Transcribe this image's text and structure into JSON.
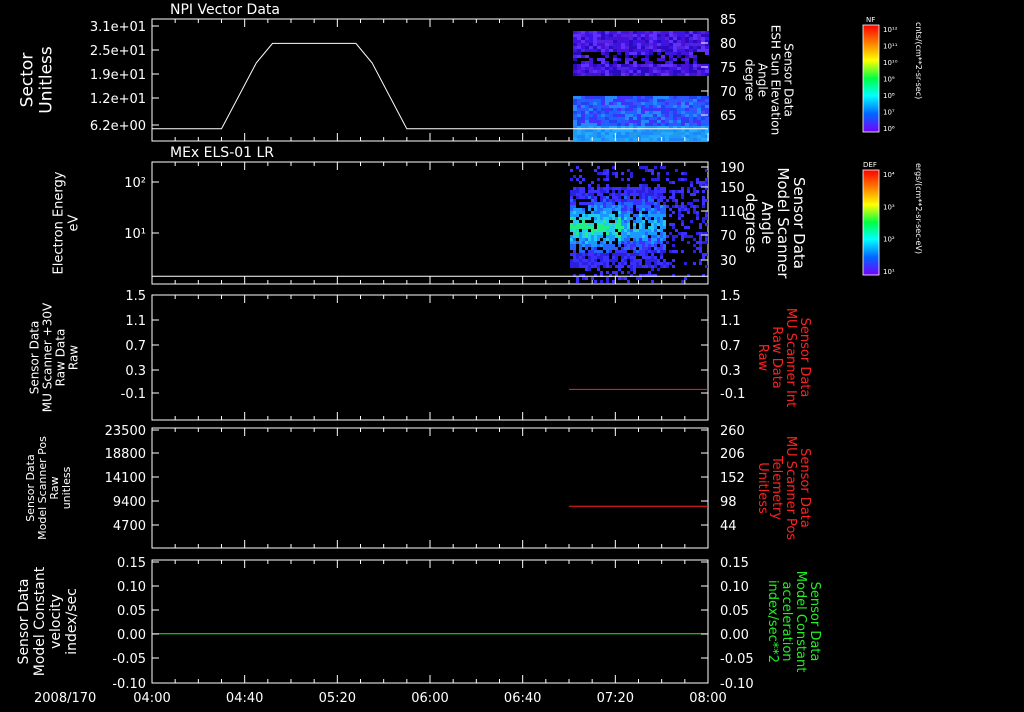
{
  "date_label": "2008/170",
  "time_ticks": [
    "04:00",
    "04:40",
    "05:20",
    "06:00",
    "06:40",
    "07:20",
    "08:00"
  ],
  "colors": {
    "white": "#ffffff",
    "red": "#ff2020",
    "green": "#22ee22"
  },
  "chart_data": [
    {
      "type": "line",
      "title": "NPI Vector Data",
      "left_axis": {
        "label_lines": [
          "Sector",
          "Unitless"
        ],
        "ticks": [
          "3.1e+01",
          "2.5e+01",
          "1.9e+01",
          "1.2e+01",
          "6.2e+00"
        ]
      },
      "right_axis": {
        "label_lines": [
          "Sensor Data",
          "ESH Sun Elevation",
          "Angle",
          "degree"
        ],
        "ticks": [
          "85",
          "80",
          "75",
          "70",
          "65"
        ],
        "ylim": [
          60,
          85
        ]
      },
      "series": [
        {
          "x": [
            "04:00",
            "04:30",
            "04:45",
            "04:52",
            "05:28",
            "05:35",
            "05:50",
            "08:00"
          ],
          "values": [
            62.5,
            62.5,
            76,
            80,
            80,
            76,
            62.5,
            62.5
          ]
        }
      ],
      "colorbar": {
        "label": "NF",
        "units": "cnts/(cm**2-sr-sec)",
        "ticks": [
          "10¹²",
          "10¹¹",
          "10¹⁰",
          "10⁹",
          "10⁸",
          "10⁷",
          "10⁶"
        ]
      }
    },
    {
      "type": "heatmap",
      "title": "MEx ELS-01 LR",
      "left_axis": {
        "label_lines": [
          "Electron Energy",
          "eV"
        ],
        "ticks": [
          "10²",
          "10¹"
        ]
      },
      "right_axis": {
        "label_lines": [
          "Sensor Data",
          "Model Scanner",
          "Angle",
          "degrees"
        ],
        "ticks": [
          "190",
          "150",
          "110",
          "70",
          "30"
        ],
        "ylim": [
          0,
          190
        ]
      },
      "series": [
        {
          "x": [
            "04:00",
            "08:00"
          ],
          "values": [
            12,
            12
          ]
        }
      ],
      "colorbar": {
        "label": "DEF",
        "units": "ergs/(cm**2-sr-sec-eV)",
        "ticks": [
          "10⁴",
          "10³",
          "10²",
          "10¹"
        ]
      }
    },
    {
      "type": "line",
      "left_axis": {
        "label_lines": [
          "Sensor Data",
          "MU Scanner +30V",
          "Raw Data",
          "Raw"
        ],
        "ticks": [
          "1.5",
          "1.1",
          "0.7",
          "0.3",
          "-0.1"
        ],
        "ylim": [
          -0.5,
          1.5
        ]
      },
      "right_axis": {
        "label_lines": [
          "Sensor Data",
          "MU Scanner Int",
          "Raw Data",
          "Raw"
        ],
        "ticks": [
          "1.5",
          "1.1",
          "0.7",
          "0.3",
          "-0.1"
        ]
      },
      "series": [
        {
          "x": [
            "07:00",
            "08:00"
          ],
          "values": [
            -0.01,
            -0.01
          ]
        }
      ]
    },
    {
      "type": "line",
      "left_axis": {
        "label_lines": [
          "Sensor Data",
          "Model Scanner Pos",
          "Raw",
          "unitless"
        ],
        "ticks": [
          "23500",
          "18800",
          "14100",
          "9400",
          "4700"
        ],
        "ylim": [
          0,
          23500
        ]
      },
      "right_axis": {
        "label_lines": [
          "Sensor Data",
          "MU Scanner Pos",
          "Telemetry",
          "Unitless"
        ],
        "ticks": [
          "260",
          "206",
          "152",
          "98",
          "44"
        ],
        "ylim": [
          -10,
          260
        ]
      },
      "series": [
        {
          "x": [
            "07:00",
            "08:00"
          ],
          "values": [
            84,
            84
          ]
        }
      ]
    },
    {
      "type": "line",
      "left_axis": {
        "label_lines": [
          "Sensor Data",
          "Model Constant",
          "velocity",
          "index/sec"
        ],
        "ticks": [
          "0.15",
          "0.10",
          "0.05",
          "0.00",
          "-0.05",
          "-0.10"
        ],
        "ylim": [
          -0.1,
          0.15
        ]
      },
      "right_axis": {
        "label_lines": [
          "Sensor Data",
          "Model Constant",
          "acceleration",
          "index/sec**2"
        ],
        "ticks": [
          "0.15",
          "0.10",
          "0.05",
          "0.00",
          "-0.05",
          "-0.10"
        ]
      },
      "series": [
        {
          "x": [
            "04:00",
            "08:00"
          ],
          "values": [
            0,
            0
          ]
        }
      ]
    }
  ]
}
